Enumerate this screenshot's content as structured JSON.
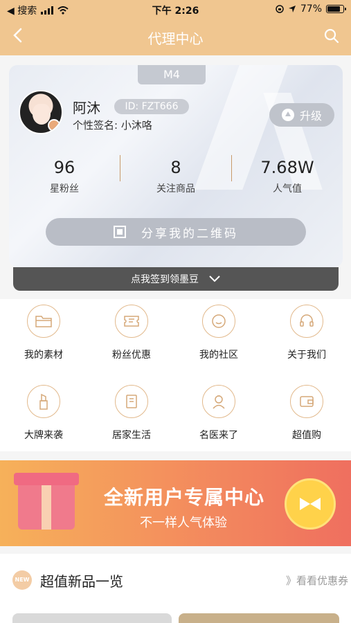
{
  "status_bar": {
    "back_app": "◀ 搜索",
    "time": "下午 2:26",
    "battery": "77%"
  },
  "nav": {
    "title": "代理中心"
  },
  "profile": {
    "level": "M4",
    "name": "阿沐",
    "id": "ID: FZT666",
    "signature": "个性签名: 小沐咯",
    "upgrade_label": "升级",
    "stats": [
      {
        "value": "96",
        "label": "星粉丝"
      },
      {
        "value": "8",
        "label": "关注商品"
      },
      {
        "value": "7.68W",
        "label": "人气值"
      }
    ],
    "qr_label": "分享我的二维码",
    "checkin_label": "点我签到领墨豆"
  },
  "grid": [
    {
      "label": "我的素材",
      "icon": "folder-icon"
    },
    {
      "label": "粉丝优惠",
      "icon": "ticket-icon"
    },
    {
      "label": "我的社区",
      "icon": "smile-icon"
    },
    {
      "label": "关于我们",
      "icon": "headset-icon"
    },
    {
      "label": "大牌来袭",
      "icon": "lipstick-icon"
    },
    {
      "label": "居家生活",
      "icon": "book-icon"
    },
    {
      "label": "名医来了",
      "icon": "doctor-icon"
    },
    {
      "label": "超值购",
      "icon": "wallet-icon"
    }
  ],
  "banner": {
    "title": "全新用户专属中心",
    "subtitle": "不一样人气体验"
  },
  "section": {
    "badge": "NEW",
    "title": "超值新品一览",
    "link": "》看看优惠券"
  },
  "colors": {
    "header": "#f0c690",
    "accent_line": "#e2b98c",
    "banner_start": "#f6b15a",
    "banner_end": "#ef6f5f"
  }
}
